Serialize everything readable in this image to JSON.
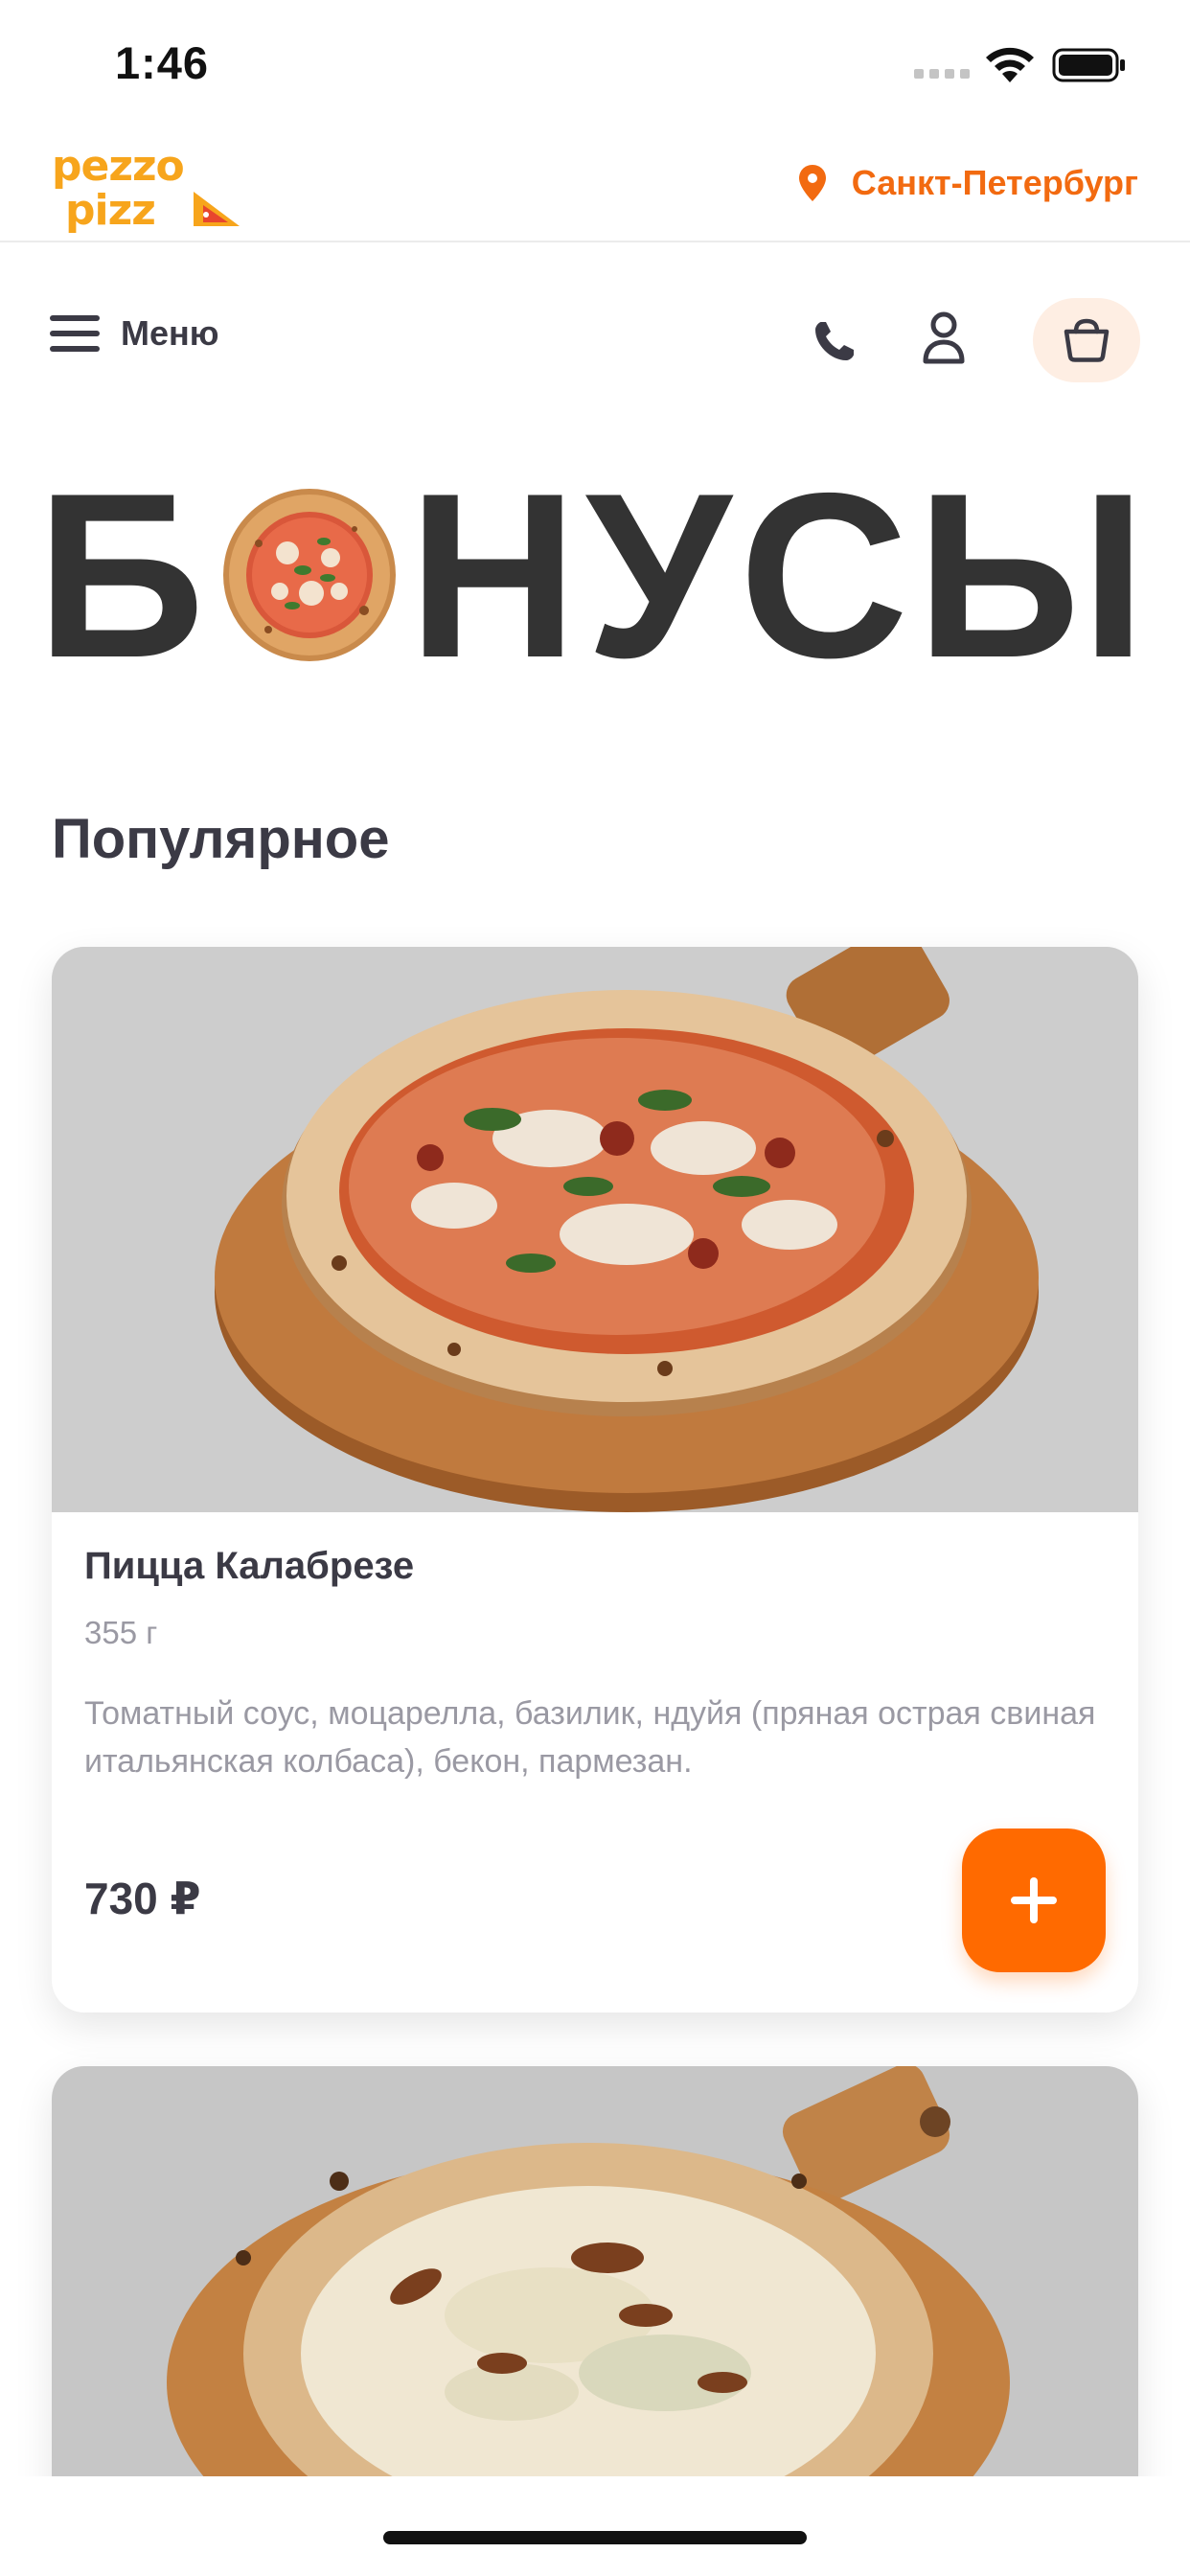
{
  "status_bar": {
    "time": "1:46"
  },
  "header": {
    "logo_text": "Pezzo Pizza",
    "city": "Санкт-Петербург"
  },
  "nav": {
    "menu_label": "Меню"
  },
  "hero": {
    "title_first_letter": "Б",
    "title_rest": "НУСЫ"
  },
  "section": {
    "title": "Популярное"
  },
  "products": [
    {
      "name": "Пицца Калабрезе",
      "weight": "355 г",
      "description": "Томатный соус, моцарелла, базилик, ндуйя (пряная острая свиная итальянская колбаса), бекон, пармезан.",
      "price": "730 ₽"
    }
  ],
  "colors": {
    "accent": "#ff6a00",
    "city_text": "#f26a10",
    "cart_bg": "#feeee3",
    "text_dark": "#3b3a45",
    "text_muted": "#9a99a3"
  },
  "icons": [
    "wifi-icon",
    "battery-icon",
    "pin-icon",
    "hamburger-icon",
    "phone-icon",
    "user-icon",
    "cart-icon",
    "plus-icon"
  ]
}
